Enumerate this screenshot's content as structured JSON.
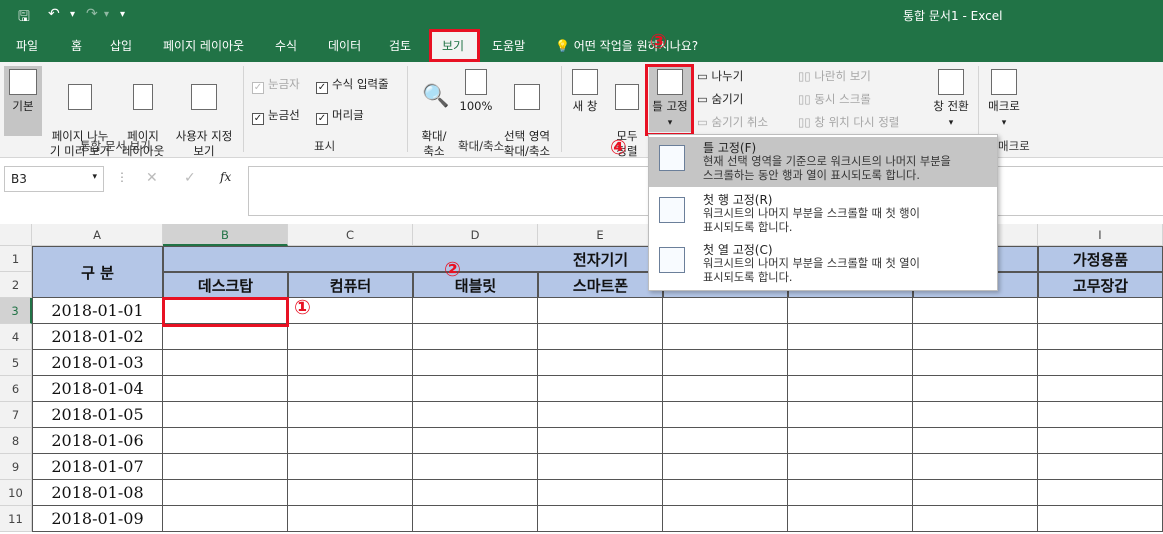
{
  "titlebar": {
    "doc": "통합 문서1",
    "sep": "-",
    "app": "Excel",
    "save_icon": "save-icon",
    "undo_icon": "undo-icon",
    "redo_icon": "redo-icon"
  },
  "tabs": [
    "파일",
    "홈",
    "삽입",
    "페이지 레이아웃",
    "수식",
    "데이터",
    "검토",
    "보기",
    "도움말"
  ],
  "tell_me": "어떤 작업을 원하시나요?",
  "ribbon": {
    "workbook_views": {
      "normal": "기본",
      "page_break": "페이지 나누\n기 미리 보기",
      "page_layout": "페이지\n레이아웃",
      "custom": "사용자 지정\n보기",
      "label": "통합 문서 보기"
    },
    "show": {
      "ruler": "눈금자",
      "formula_bar": "수식 입력줄",
      "gridlines": "눈금선",
      "headings": "머리글",
      "label": "표시"
    },
    "zoom": {
      "zoom": "확대/\n축소",
      "hundred": "100%",
      "zoom_sel": "선택 영역\n확대/축소",
      "label": "확대/축소"
    },
    "window": {
      "new": "새 창",
      "arrange": "모두\n정렬",
      "freeze": "틀 고정",
      "split": "나누기",
      "hide": "숨기기",
      "unhide": "숨기기 취소",
      "side": "나란히 보기",
      "sync": "동시 스크롤",
      "reset": "창 위치 다시 정렬",
      "switch": "창 전환",
      "macro": "매크로",
      "macro_label": "매크로"
    }
  },
  "formula": {
    "namebox": "B3",
    "cancel": "✕",
    "enter": "✓",
    "fx": "fx"
  },
  "columns": [
    "A",
    "B",
    "C",
    "D",
    "E",
    "F",
    "G",
    "H",
    "I"
  ],
  "rows": [
    "1",
    "2",
    "3",
    "4",
    "5",
    "6",
    "7",
    "8",
    "9",
    "10",
    "11"
  ],
  "sheet": {
    "a12": "구 분",
    "group_electronics": "전자기기",
    "group_home": "가정용품",
    "headers": [
      "데스크탑",
      "컴퓨터",
      "태블릿",
      "스마트폰",
      "",
      "",
      "",
      "고무장갑"
    ],
    "dates": [
      "2018-01-01",
      "2018-01-02",
      "2018-01-03",
      "2018-01-04",
      "2018-01-05",
      "2018-01-06",
      "2018-01-07",
      "2018-01-08",
      "2018-01-09"
    ]
  },
  "dropdown": [
    {
      "title": "틀 고정(F)",
      "desc": "현재 선택 영역을 기준으로 워크시트의 나머지 부분을\n스크롤하는 동안 행과 열이 표시되도록 합니다."
    },
    {
      "title": "첫 행 고정(R)",
      "desc": "워크시트의 나머지 부분을 스크롤할 때 첫 행이\n표시되도록 합니다."
    },
    {
      "title": "첫 열 고정(C)",
      "desc": "워크시트의 나머지 부분을 스크롤할 때 첫 열이\n표시되도록 합니다."
    }
  ],
  "markers": {
    "m1": "①",
    "m2": "②",
    "m3": "③",
    "m4": "④"
  },
  "colors": {
    "excel_green": "#217346",
    "header_blue": "#b4c6e7",
    "highlight_red": "#e81123"
  }
}
